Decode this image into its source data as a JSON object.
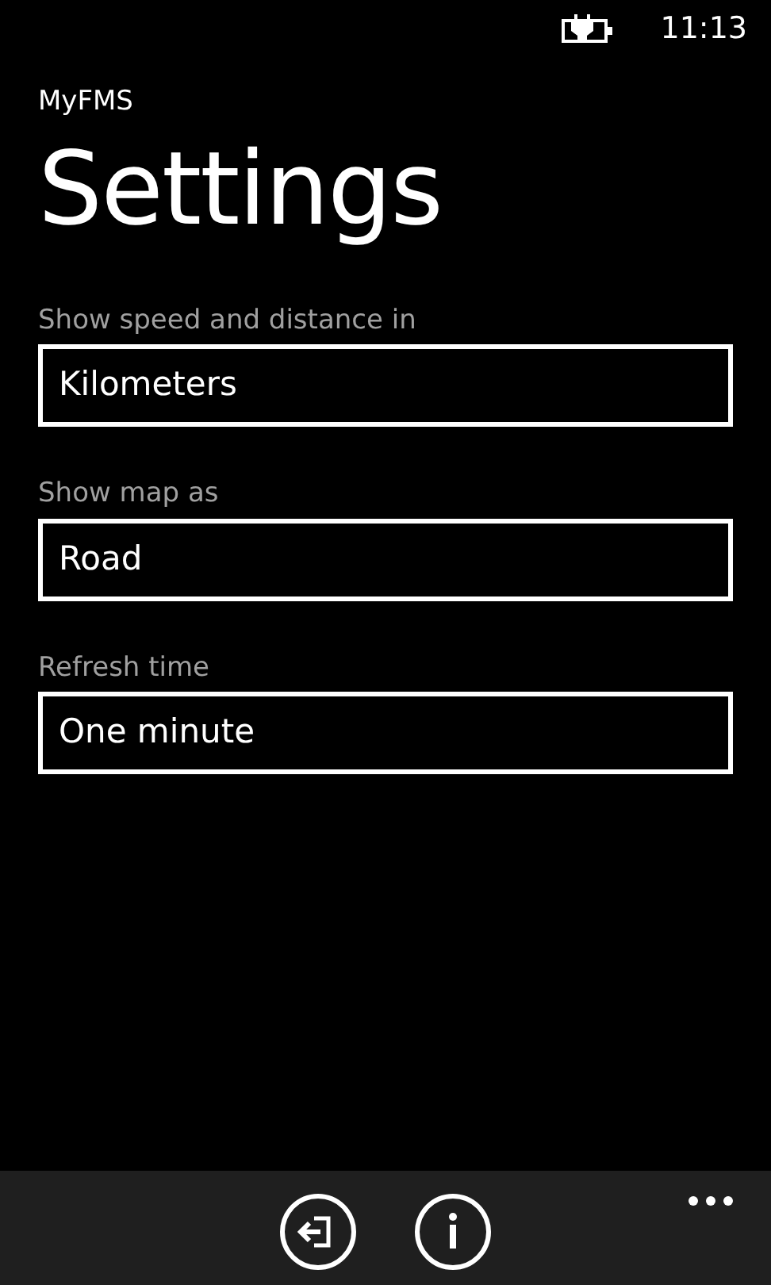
{
  "status_bar": {
    "time": "11:13"
  },
  "app_title": "MyFMS",
  "page_title": "Settings",
  "settings": [
    {
      "label": "Show speed and distance in",
      "value": "Kilometers"
    },
    {
      "label": "Show map as",
      "value": "Road"
    },
    {
      "label": "Refresh time",
      "value": "One minute"
    }
  ]
}
